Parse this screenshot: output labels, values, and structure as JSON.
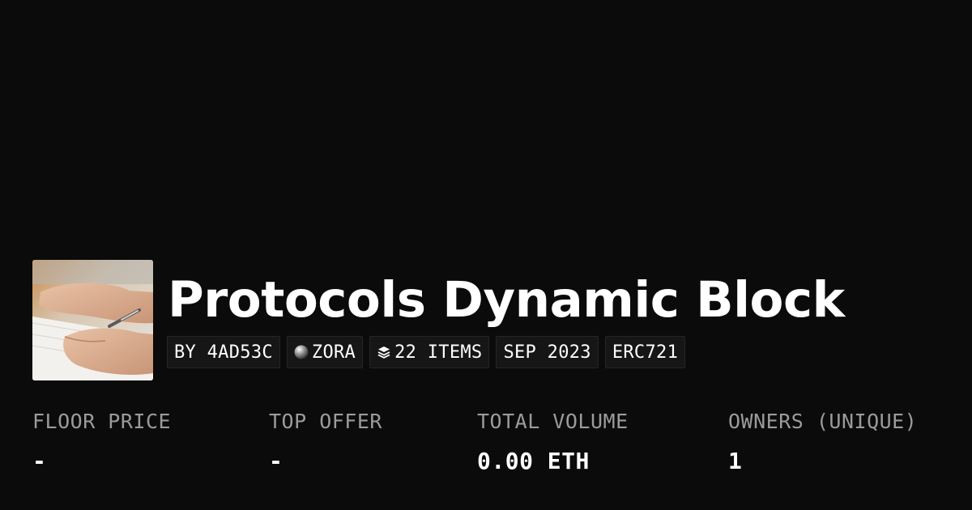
{
  "collection": {
    "title": "Protocols Dynamic Block",
    "thumbnail_icon": "hand-writing-photo"
  },
  "chips": [
    {
      "label": "BY 4AD53C",
      "icon": ""
    },
    {
      "label": "ZORA",
      "icon": "zora-orb-icon"
    },
    {
      "label": "22 ITEMS",
      "icon": "layers-icon"
    },
    {
      "label": "SEP 2023",
      "icon": ""
    },
    {
      "label": "ERC721",
      "icon": ""
    }
  ],
  "stats": [
    {
      "label": "FLOOR PRICE",
      "value": "-"
    },
    {
      "label": "TOP OFFER",
      "value": "-"
    },
    {
      "label": "TOTAL VOLUME",
      "value": "0.00 ETH"
    },
    {
      "label": "OWNERS (UNIQUE)",
      "value": "1"
    }
  ],
  "colors": {
    "background": "#0b0b0b",
    "chip_background": "#161616",
    "chip_border": "#262626",
    "label_gray": "#9b9b9b",
    "text": "#ffffff"
  }
}
